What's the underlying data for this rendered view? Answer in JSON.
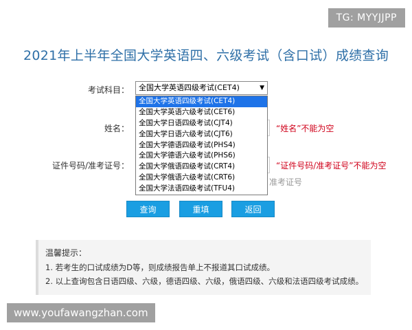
{
  "watermarks": {
    "top": "TG: MYYJJPP",
    "bottom": "www.youfawangzhan.com"
  },
  "page": {
    "title": "2021年上半年全国大学英语四、六级考试（含口试）成绩查询"
  },
  "form": {
    "subject_label": "考试科目：",
    "subject_selected": "全国大学英语四级考试(CET4)",
    "subject_options": [
      "全国大学英语四级考试(CET4)",
      "全国大学英语六级考试(CET6)",
      "全国大学日语四级考试(CJT4)",
      "全国大学日语六级考试(CJT6)",
      "全国大学德语四级考试(PHS4)",
      "全国大学德语六级考试(PHS6)",
      "全国大学俄语四级考试(CRT4)",
      "全国大学俄语六级考试(CRT6)",
      "全国大学法语四级考试(TFU4)"
    ],
    "name_label": "姓名：",
    "name_error": "“姓名”不能为空",
    "id_label": "证件号码/准考证号：",
    "id_error": "“证件号码/准考证号”不能为空",
    "id_hint": "准考证号"
  },
  "buttons": {
    "query": "查询",
    "reset": "重填",
    "back": "返回"
  },
  "tips": {
    "title": "温馨提示：",
    "lines": [
      "1. 若考生的口试成绩为D等，则成绩报告单上不报道其口试成绩。",
      "2. 以上查询包含日语四级、六级，德语四级、六级，俄语四级、六级和法语四级考试成绩。"
    ]
  },
  "colors": {
    "title": "#2e6fa7",
    "button": "#1a9ee2",
    "error": "#d0021b",
    "selected_option": "#1e73e8"
  },
  "icons": {
    "select_arrow": "chevron-down-icon"
  }
}
